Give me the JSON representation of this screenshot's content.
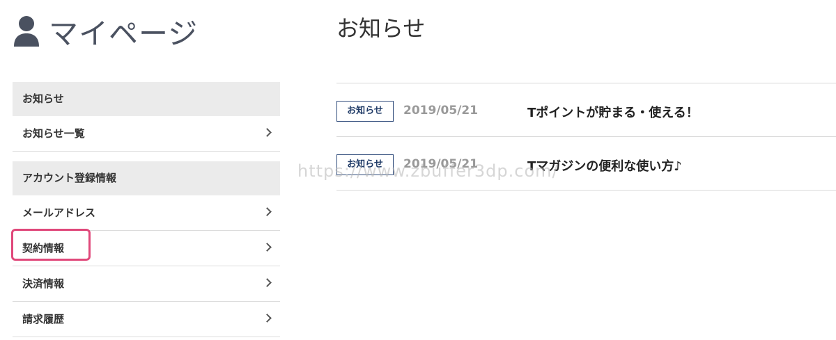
{
  "header": {
    "title": "マイページ",
    "icon": "user-icon"
  },
  "sidebar": {
    "sections": [
      {
        "heading": "お知らせ",
        "items": [
          {
            "label": "お知らせ一覧"
          }
        ]
      },
      {
        "heading": "アカウント登録情報",
        "items": [
          {
            "label": "メールアドレス"
          },
          {
            "label": "契約情報",
            "highlighted": true
          },
          {
            "label": "決済情報"
          },
          {
            "label": "請求履歴"
          }
        ]
      }
    ]
  },
  "main": {
    "title": "お知らせ",
    "news": [
      {
        "badge": "お知らせ",
        "date": "2019/05/21",
        "text": "Tポイントが貯まる・使える！"
      },
      {
        "badge": "お知らせ",
        "date": "2019/05/21",
        "text": "Tマガジンの便利な使い方♪"
      }
    ]
  },
  "watermark": "https://www.zbuffer3dp.com/",
  "colors": {
    "highlight": "#e0487a",
    "badge_border": "#2e4a7a",
    "section_bg": "#ebebeb"
  }
}
